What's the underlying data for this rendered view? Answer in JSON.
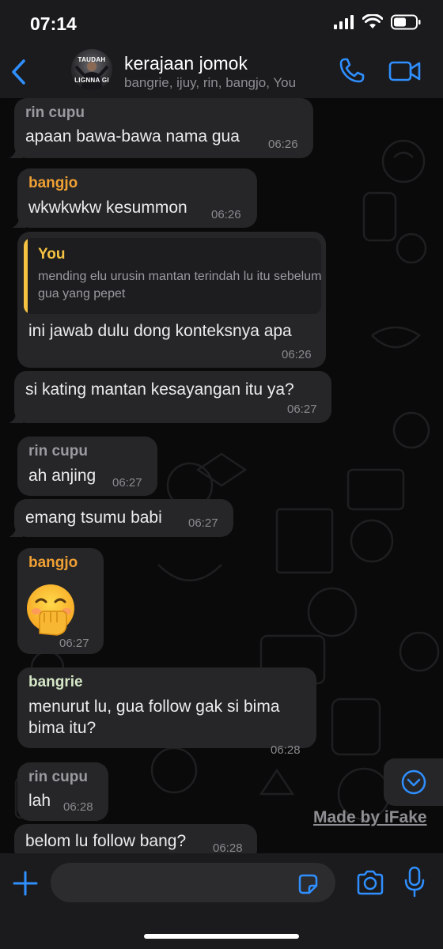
{
  "status_bar": {
    "time": "07:14"
  },
  "header": {
    "title": "kerajaan jomok",
    "subtitle": "bangrie, ijuy, rin, bangjo, You",
    "avatar_text_top": "TAUDAH",
    "avatar_text_bottom": "LIGNNA GI"
  },
  "messages": [
    {
      "sender": "rin cupu",
      "sender_color": "#9a9aa0",
      "lines": [
        "apaan bawa-bawa nama gua"
      ],
      "time": "06:26"
    },
    {
      "sender": "bangjo",
      "sender_color": "#f0a033",
      "lines": [
        "wkwkwkw kesummon"
      ],
      "time": "06:26"
    },
    {
      "quote_name": "You",
      "quote_text": "mending elu urusin mantan terindah lu itu sebelum gua yang pepet",
      "lines": [
        "ini jawab dulu dong konteksnya apa"
      ],
      "time": "06:26"
    },
    {
      "lines": [
        "si kating mantan kesayangan itu ya?"
      ],
      "time": "06:27"
    },
    {
      "sender": "rin cupu",
      "sender_color": "#9a9aa0",
      "lines": [
        "ah anjing"
      ],
      "time": "06:27"
    },
    {
      "lines": [
        "emang tsumu babi"
      ],
      "time": "06:27"
    },
    {
      "sender": "bangjo",
      "sender_color": "#f0a033",
      "emoji": "face-with-hand-over-mouth",
      "time": "06:27"
    },
    {
      "sender": "bangrie",
      "sender_color": "#d6e8c8",
      "lines": [
        "menurut lu, gua follow gak si bima",
        "bima itu?"
      ],
      "time": "06:28"
    },
    {
      "sender": "rin cupu",
      "sender_color": "#9a9aa0",
      "lines": [
        "lah"
      ],
      "time": "06:28"
    },
    {
      "lines": [
        "belom lu follow bang?"
      ],
      "time": "06:28"
    }
  ],
  "watermark": "Made by iFake",
  "composer": {
    "placeholder": ""
  },
  "colors": {
    "accent": "#2f8fff",
    "bubble": "#262628",
    "quote_bar": "#f5c242"
  }
}
